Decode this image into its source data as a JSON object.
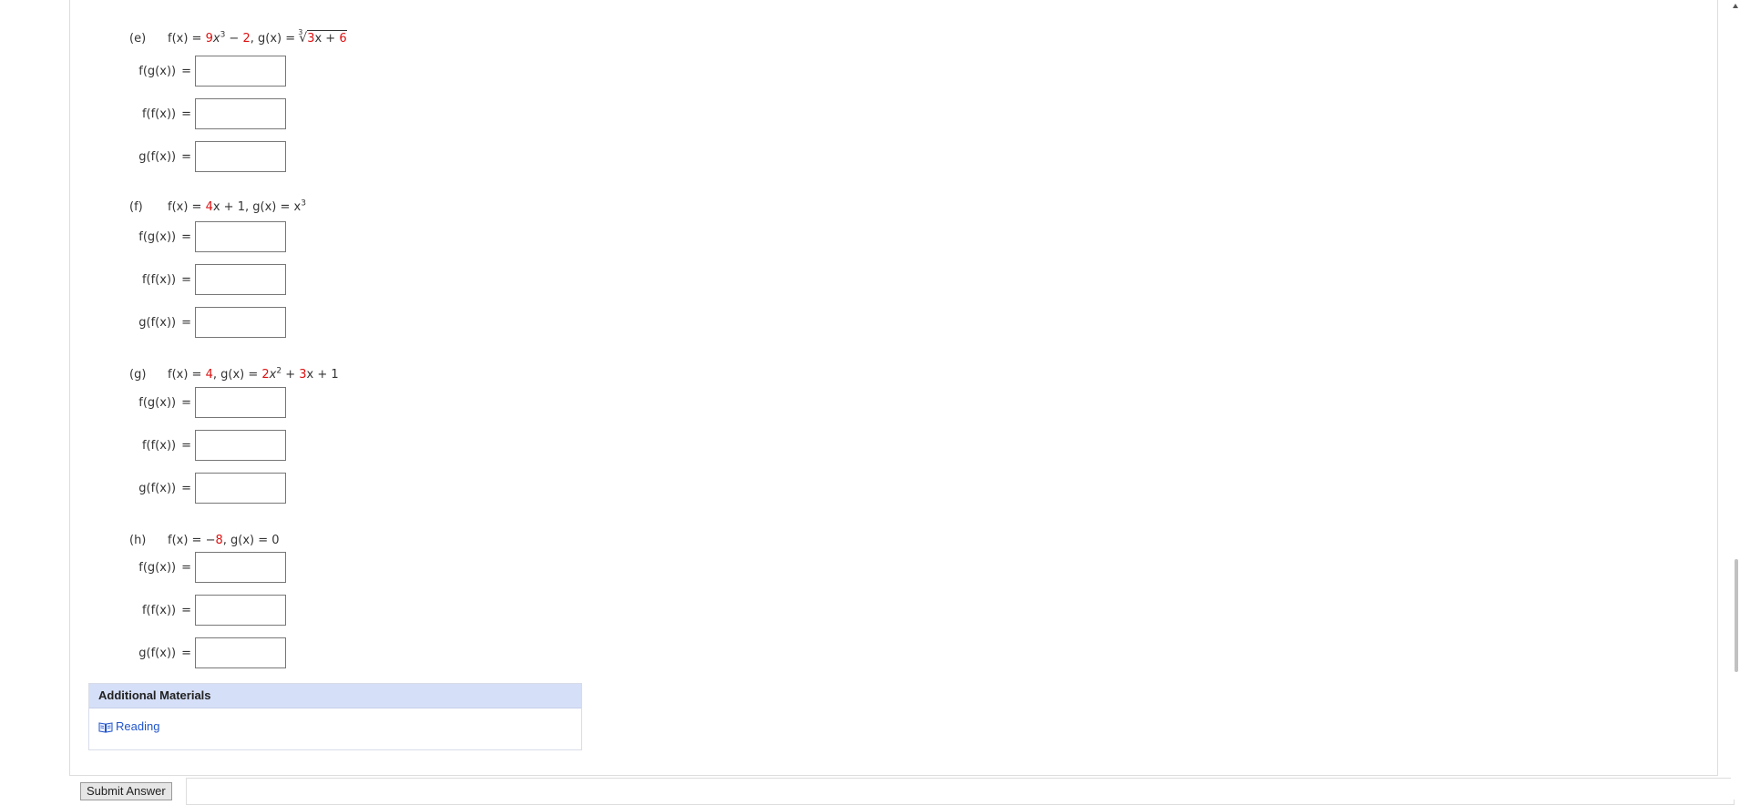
{
  "parts": [
    {
      "letter": "(e)",
      "f_prefix": "f(x) = ",
      "f_coef": "9",
      "f_mid": "x",
      "f_exp": "3",
      "f_tail": " − ",
      "f_const": "2",
      "g_prefix": ", g(x) = ",
      "g_root_index": "3",
      "g_inner_coef": "3",
      "g_inner_mid": "x + ",
      "g_inner_const": "6"
    },
    {
      "letter": "(f)",
      "f_prefix": "f(x) = ",
      "f_coef": "4",
      "f_rest": "x + 1",
      "g_prefix": ", g(x) = x",
      "g_exp": "3"
    },
    {
      "letter": "(g)",
      "f_prefix": "f(x) = ",
      "f_const": "4",
      "g_prefix": ", g(x) = ",
      "g_coef1": "2",
      "g_mid1": "x",
      "g_exp": "2",
      "g_mid2": " + ",
      "g_coef2": "3",
      "g_tail": "x + 1"
    },
    {
      "letter": "(h)",
      "f_prefix": "f(x) = −",
      "f_const": "8",
      "g_tail": ", g(x) = 0"
    }
  ],
  "rows": {
    "fg": "f(g(x))",
    "ff": "f(f(x))",
    "gf": "g(f(x))",
    "eq": "="
  },
  "materials": {
    "title": "Additional Materials",
    "link": "Reading"
  },
  "submit_label": "Submit Answer",
  "colors": {
    "highlight": "#dd1111",
    "link": "#2255cc",
    "materials_header": "#d5dff7"
  },
  "icons": {
    "book": "book-icon"
  }
}
